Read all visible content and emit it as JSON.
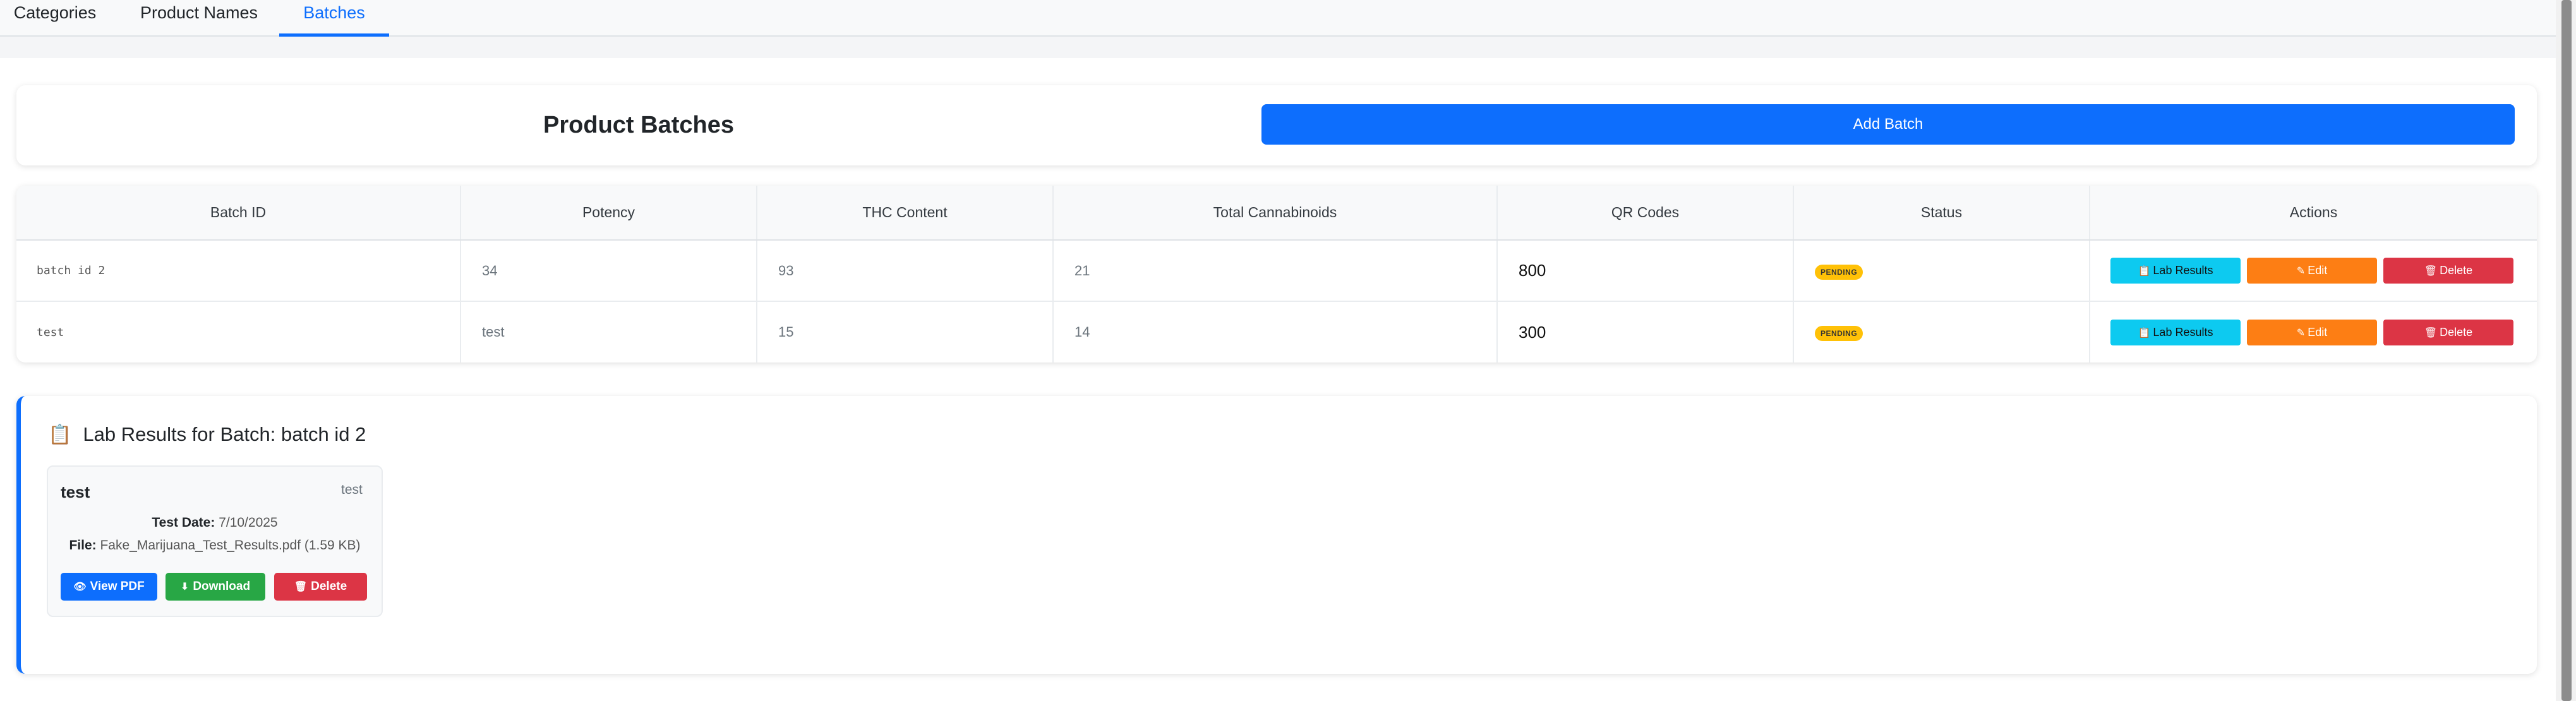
{
  "tabs": [
    {
      "label": "Categories",
      "active": false
    },
    {
      "label": "Product Names",
      "active": false
    },
    {
      "label": "Batches",
      "active": true
    }
  ],
  "header": {
    "title": "Product Batches",
    "add_button": "Add Batch"
  },
  "table": {
    "columns": [
      "Batch ID",
      "Potency",
      "THC Content",
      "Total Cannabinoids",
      "QR Codes",
      "Status",
      "Actions"
    ],
    "rows": [
      {
        "batch_id": "batch id 2",
        "potency": "34",
        "thc": "93",
        "total": "21",
        "qr": "800",
        "status": "PENDING"
      },
      {
        "batch_id": "test",
        "potency": "test",
        "thc": "15",
        "total": "14",
        "qr": "300",
        "status": "PENDING"
      }
    ],
    "actions": {
      "lab": "Lab Results",
      "edit": "Edit",
      "delete": "Delete"
    }
  },
  "lab_results": {
    "title": "Lab Results for Batch: batch id 2",
    "card": {
      "name": "test",
      "type": "test",
      "test_date_label": "Test Date:",
      "test_date": "7/10/2025",
      "file_label": "File:",
      "file": "Fake_Marijuana_Test_Results.pdf (1.59 KB)",
      "view_button": "View PDF",
      "download_button": "Download",
      "delete_button": "Delete"
    }
  },
  "colors": {
    "primary": "#0d6efd",
    "info": "#0dcaf0",
    "warning": "#fd7e14",
    "danger": "#dc3545",
    "success": "#28a745",
    "badge": "#ffc107"
  },
  "icons": {
    "lab": "clipboard-icon",
    "edit": "pencil-icon",
    "delete": "trash-icon",
    "view": "eye-icon",
    "download": "download-icon"
  }
}
